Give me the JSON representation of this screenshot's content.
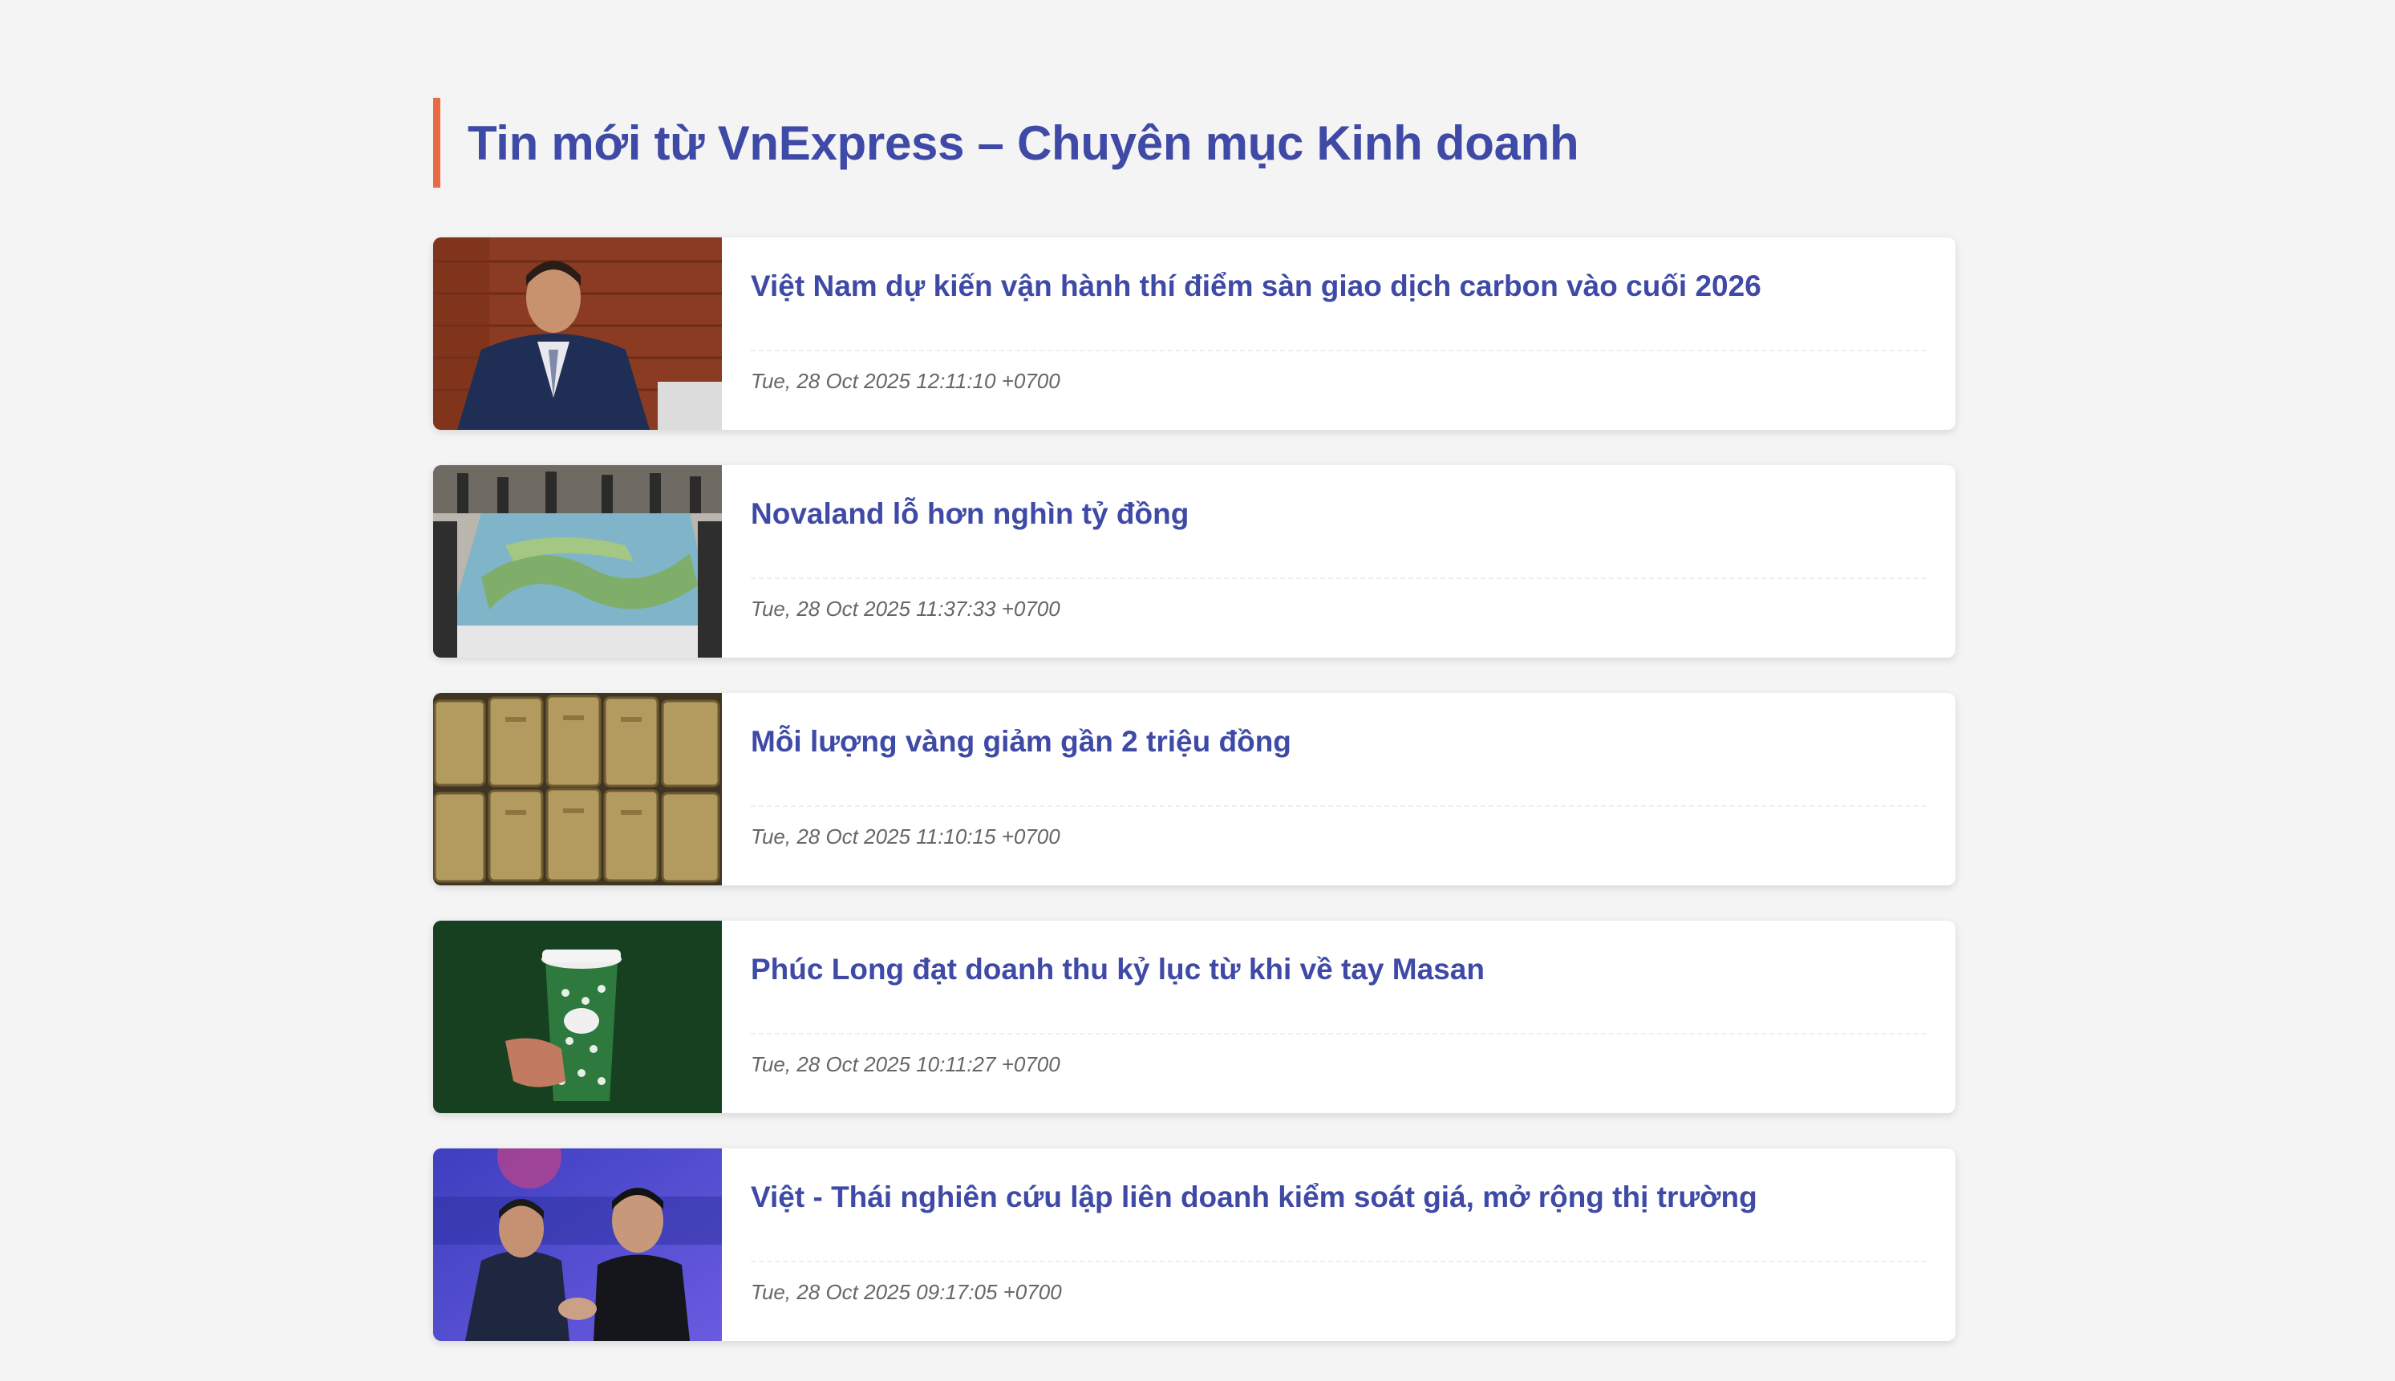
{
  "page": {
    "title": "Tin mới từ VnExpress – Chuyên mục Kinh doanh",
    "accent_color": "#ea6a43",
    "title_color": "#3f4aa6"
  },
  "articles": [
    {
      "title": "Việt Nam dự kiến vận hành thí điểm sàn giao dịch carbon vào cuối 2026",
      "date": "Tue, 28 Oct 2025 12:11:10 +0700",
      "image": "speaker-at-podium-photo"
    },
    {
      "title": "Novaland lỗ hơn nghìn tỷ đồng",
      "date": "Tue, 28 Oct 2025 11:37:33 +0700",
      "image": "real-estate-model-photo"
    },
    {
      "title": "Mỗi lượng vàng giảm gần 2 triệu đồng",
      "date": "Tue, 28 Oct 2025 11:10:15 +0700",
      "image": "gold-bars-photo"
    },
    {
      "title": "Phúc Long đạt doanh thu kỷ lục từ khi về tay Masan",
      "date": "Tue, 28 Oct 2025 10:11:27 +0700",
      "image": "coffee-cup-photo"
    },
    {
      "title": "Việt - Thái nghiên cứu lập liên doanh kiểm soát giá, mở rộng thị trường",
      "date": "Tue, 28 Oct 2025 09:17:05 +0700",
      "image": "handshake-photo"
    }
  ]
}
